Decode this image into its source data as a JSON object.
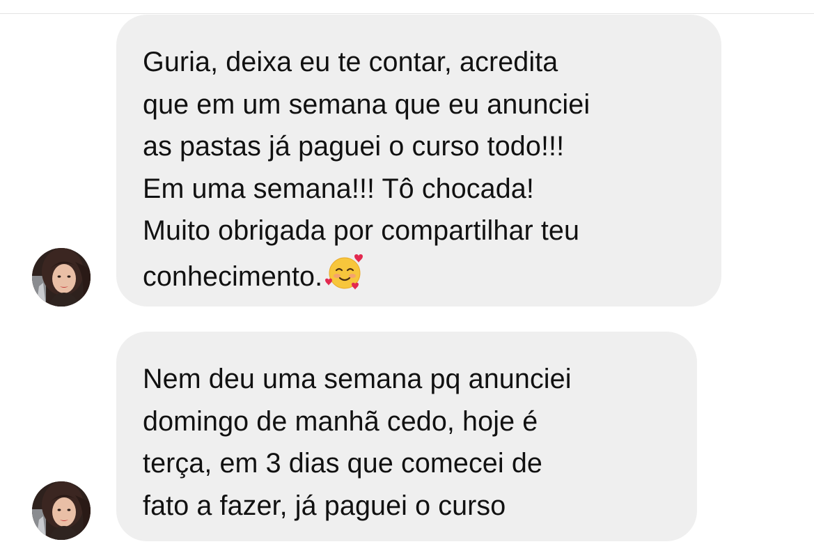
{
  "conversation": {
    "messages": [
      {
        "sender": "contact",
        "lines": [
          "Guria, deixa eu te contar, acredita",
          "que em um semana que eu anunciei",
          "as pastas já paguei o curso todo!!!",
          "Em uma semana!!! Tô chocada!",
          "Muito obrigada por compartilhar teu",
          "conhecimento."
        ],
        "trailing_emoji": "smiling-face-with-hearts"
      },
      {
        "sender": "contact",
        "lines": [
          "Nem deu uma semana pq anunciei",
          "domingo de manhã cedo, hoje é",
          "terça, em 3 dias que comecei de",
          "fato a fazer, já paguei o curso"
        ]
      }
    ]
  },
  "colors": {
    "bubble_background": "#efefef",
    "text": "#111111",
    "page_background": "#ffffff"
  }
}
